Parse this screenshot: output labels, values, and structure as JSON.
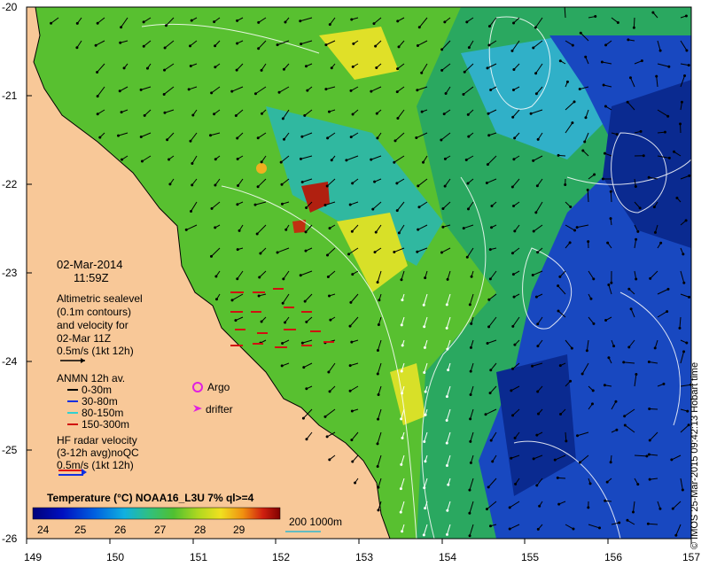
{
  "map": {
    "date": "02-Mar-2014",
    "time": "11:59Z",
    "y_ticks": [
      "-20",
      "-21",
      "-22",
      "-23",
      "-24",
      "-25",
      "-26"
    ],
    "x_ticks": [
      "149",
      "150",
      "151",
      "152",
      "153",
      "154",
      "155",
      "156",
      "157"
    ],
    "altimetry": {
      "lines": [
        "Altimetric sealevel",
        "(0.1m contours)",
        "and velocity for",
        "02-Mar 11Z"
      ],
      "scale": "0.5m/s (1kt 12h)"
    },
    "anmn": {
      "title": "ANMN 12h av.",
      "depths": [
        {
          "label": "0-30m",
          "color": "#000000"
        },
        {
          "label": "30-80m",
          "color": "#1030e0"
        },
        {
          "label": "80-150m",
          "color": "#30d0d0"
        },
        {
          "label": "150-300m",
          "color": "#d01010"
        }
      ]
    },
    "markers": {
      "argo": "Argo",
      "drifter": "drifter",
      "argo_color": "#e020e0",
      "drifter_color": "#e020e0"
    },
    "hf_radar": {
      "lines": [
        "HF radar velocity",
        "(3-12h avg)noQC"
      ],
      "scale": "0.5m/s (1kt 12h)"
    },
    "colorbar": {
      "title": "Temperature (°C) NOAA16_L3U 7% ql>=4",
      "ticks": [
        "24",
        "25",
        "26",
        "27",
        "28",
        "29"
      ]
    },
    "isobath": "200  1000m",
    "credit": "© IMOS 25-Mar-2015 09:42:13 Hobart time",
    "colors": {
      "land": "#f8c898",
      "ocean_blue": "#1040b0",
      "ocean_green": "#30b040",
      "accent_yellow": "#e8e020",
      "accent_red": "#c02010"
    }
  }
}
